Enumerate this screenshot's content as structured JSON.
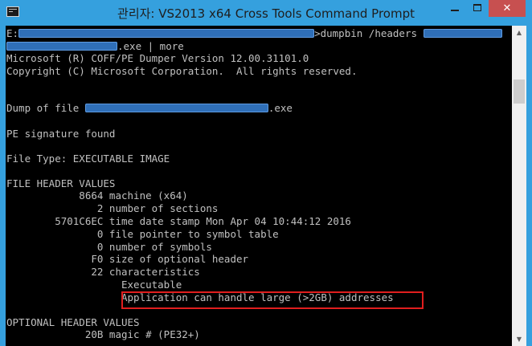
{
  "window": {
    "title": "관리자: VS2013 x64 Cross Tools Command Prompt",
    "close_glyph": "✕",
    "icons": {
      "app": "console-app-icon",
      "minimize": "minimize-icon",
      "maximize": "maximize-icon",
      "close": "close-icon"
    }
  },
  "console": {
    "line1_prefix": "E:",
    "line1_suffix": ">dumpbin /headers ",
    "line2_suffix": ".exe | more",
    "line3": "Microsoft (R) COFF/PE Dumper Version 12.00.31101.0",
    "line4": "Copyright (C) Microsoft Corporation.  All rights reserved.",
    "line5_prefix": "Dump of file ",
    "line5_suffix": ".exe",
    "line6": "PE signature found",
    "line7": "File Type: EXECUTABLE IMAGE",
    "line8": "FILE HEADER VALUES",
    "line9": "            8664 machine (x64)",
    "line10": "               2 number of sections",
    "line11": "        5701C6EC time date stamp Mon Apr 04 10:44:12 2016",
    "line12": "               0 file pointer to symbol table",
    "line13": "               0 number of symbols",
    "line14": "              F0 size of optional header",
    "line15": "              22 characteristics",
    "line16": "                   Executable",
    "line17": "                   Application can handle large (>2GB) addresses",
    "line18": "OPTIONAL HEADER VALUES",
    "line19": "             20B magic # (PE32+)"
  },
  "scrollbar": {
    "up_glyph": "▲",
    "down_glyph": "▼"
  },
  "colors": {
    "titlebar": "#35a0de",
    "console_bg": "#000000",
    "console_text": "#c0c0c0",
    "highlight_box": "#e01e1e",
    "redaction": "#2f6fb8"
  }
}
